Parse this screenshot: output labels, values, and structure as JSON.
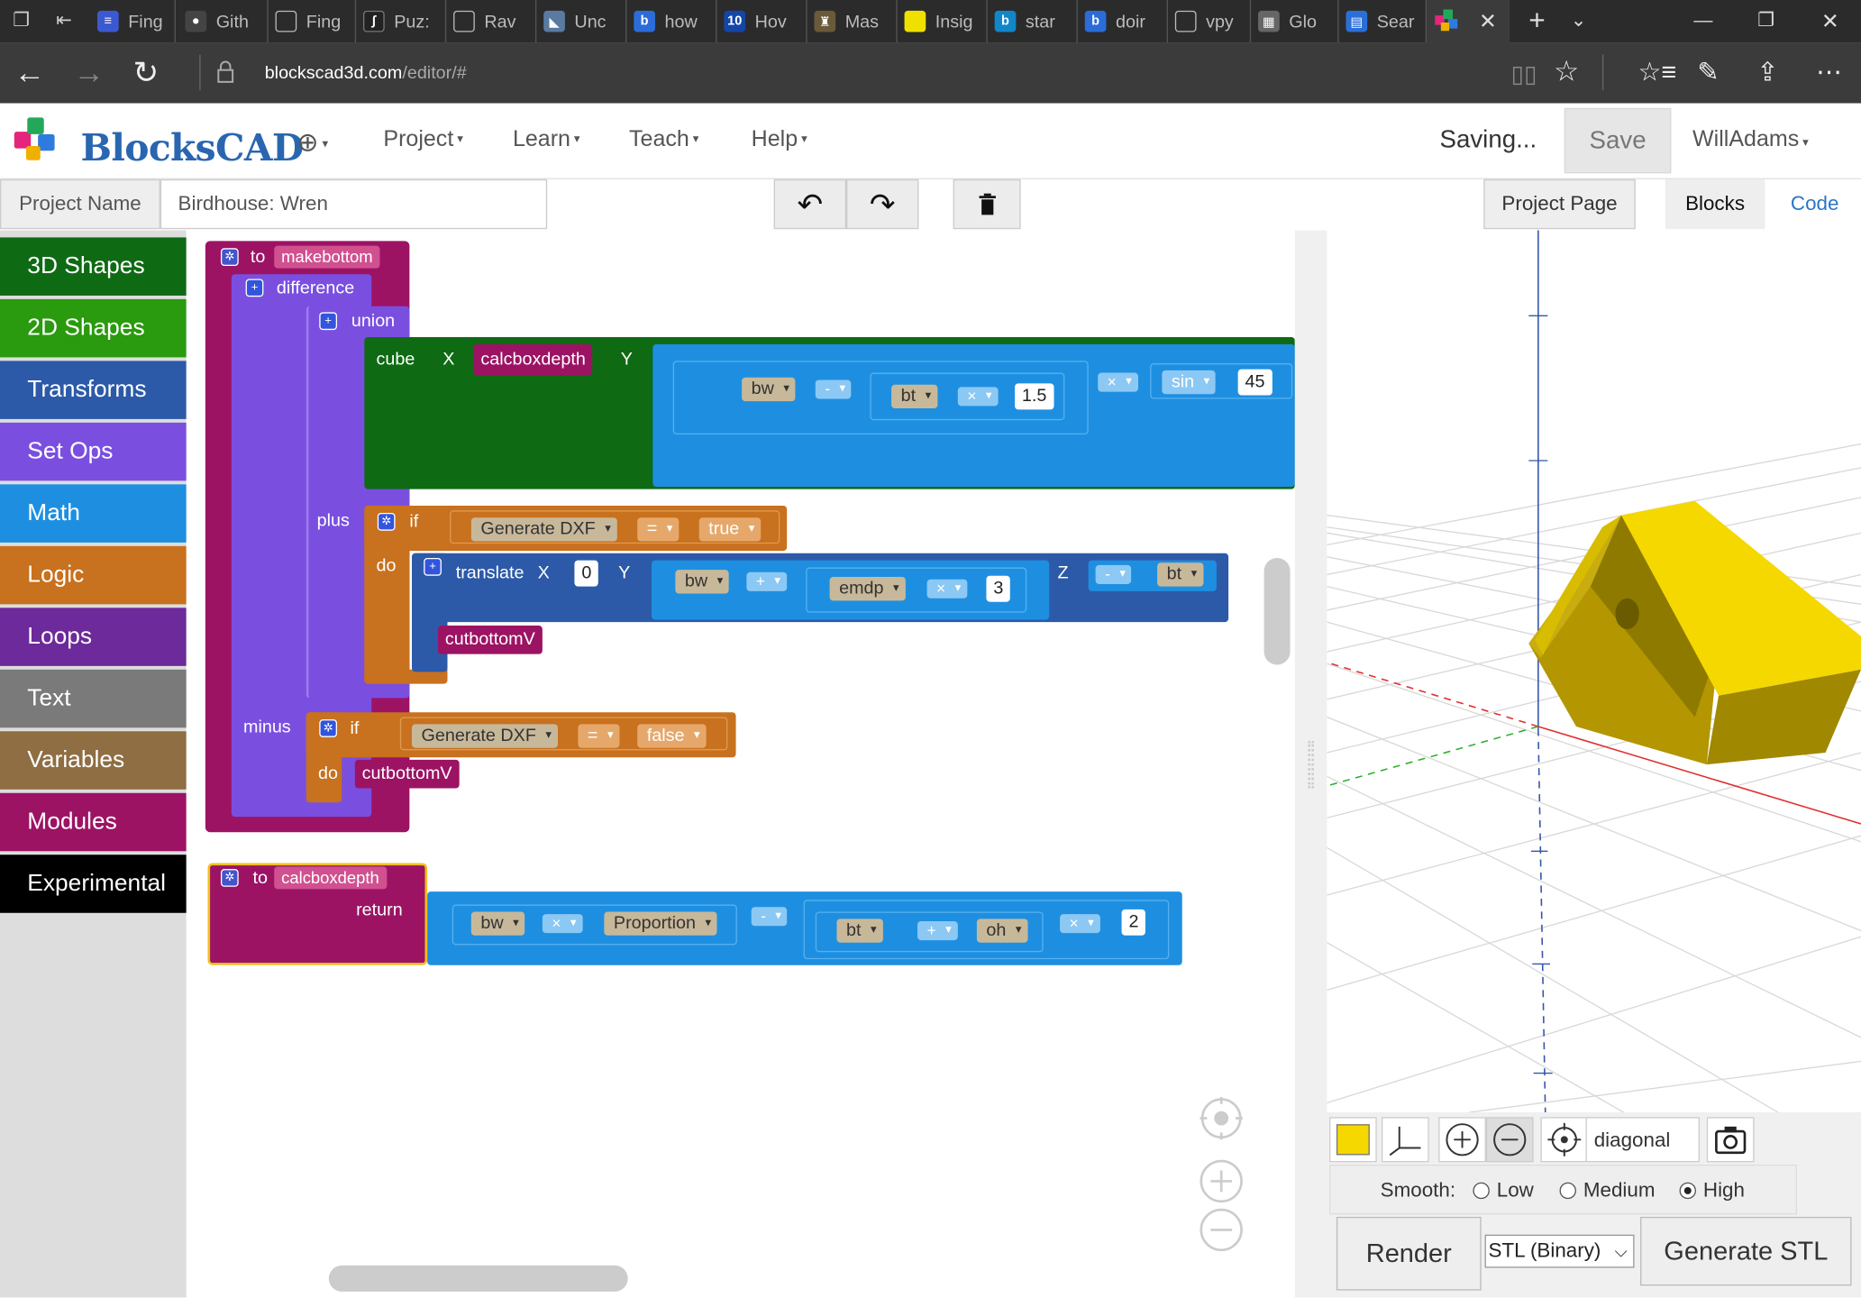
{
  "browser": {
    "tabs": [
      "Fing",
      "Gith",
      "Fing",
      "Puz:",
      "Rav",
      "Unc",
      "how",
      "Hov",
      "Mas",
      "Insig",
      "star",
      "doir",
      "vpy",
      "Glo",
      "Sear"
    ],
    "url_host": "blockscad3d.com",
    "url_path": "/editor/#"
  },
  "header": {
    "logo": "BlocksCAD",
    "menus": [
      "Project",
      "Learn",
      "Teach",
      "Help"
    ],
    "status": "Saving...",
    "save_label": "Save",
    "user": "WillAdams"
  },
  "project": {
    "name_label": "Project Name",
    "name_value": "Birdhouse: Wren",
    "project_page": "Project Page",
    "tab_blocks": "Blocks",
    "tab_code": "Code"
  },
  "categories": [
    {
      "label": "3D Shapes",
      "color": "#0f6a14"
    },
    {
      "label": "2D Shapes",
      "color": "#2a9a0e"
    },
    {
      "label": "Transforms",
      "color": "#2c5aa8"
    },
    {
      "label": "Set Ops",
      "color": "#7a4fe0"
    },
    {
      "label": "Math",
      "color": "#1e8fe0"
    },
    {
      "label": "Logic",
      "color": "#c8711e"
    },
    {
      "label": "Loops",
      "color": "#6c2a9a"
    },
    {
      "label": "Text",
      "color": "#7a7a7a"
    },
    {
      "label": "Variables",
      "color": "#8e6e42"
    },
    {
      "label": "Modules",
      "color": "#9c1364"
    },
    {
      "label": "Experimental",
      "color": "#000000"
    }
  ],
  "blocks": {
    "to1": "to",
    "fn1": "makebottom",
    "difference": "difference",
    "union": "union",
    "cube": "cube",
    "x": "X",
    "calcboxdepth": "calcboxdepth",
    "y": "Y",
    "bw": "bw",
    "minus": "-",
    "bt": "bt",
    "times": "×",
    "n15": "1.5",
    "sin": "sin",
    "n45": "45",
    "plus": "plus",
    "if": "if",
    "generate_dxf": "Generate DXF",
    "eq": "=",
    "true": "true",
    "do": "do",
    "translate": "translate",
    "n0": "0",
    "plus_op": "+",
    "emdp": "emdp",
    "n3": "3",
    "z": "Z",
    "cutbottom": "cutbottomV",
    "minus_label": "minus",
    "false": "false",
    "to2": "to",
    "fn2": "calcboxdepth",
    "return": "return",
    "proportion": "Proportion",
    "oh": "oh",
    "n2": "2"
  },
  "view": {
    "camera": "diagonal",
    "smooth_label": "Smooth:",
    "smooth_options": [
      "Low",
      "Medium",
      "High"
    ],
    "smooth_selected": "High",
    "color_swatch": "#f5d800",
    "render": "Render",
    "format": "STL (Binary)",
    "generate": "Generate STL"
  }
}
